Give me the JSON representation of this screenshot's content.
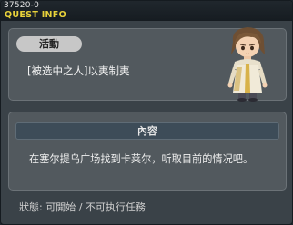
{
  "window": {
    "quest_id": "37520-0",
    "title": "QUEST INFO"
  },
  "activity": {
    "badge_label": "活動",
    "quest_name": "[被选中之人]以夷制夷"
  },
  "content": {
    "header": "內容",
    "description": "在塞尔提乌广场找到卡莱尔，听取目前的情况吧。"
  },
  "status": {
    "text": "狀態:  可開始 / 不可执行任務"
  },
  "colors": {
    "title_accent": "#e8d23a",
    "panel": "#52595e",
    "window_bg": "#3a4248"
  }
}
